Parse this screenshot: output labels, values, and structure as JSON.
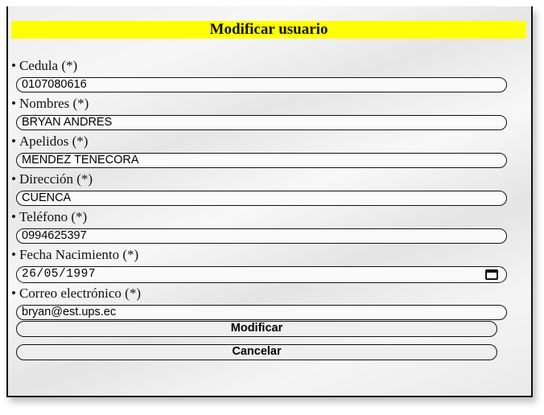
{
  "form": {
    "title": "Modificar usuario",
    "bullet": "•",
    "fields": [
      {
        "label": "Cedula (*)",
        "value": "0107080616"
      },
      {
        "label": "Nombres (*)",
        "value": "BRYAN ANDRES"
      },
      {
        "label": "Apelidos (*)",
        "value": "MENDEZ TENECORA"
      },
      {
        "label": "Dirección (*)",
        "value": "CUENCA"
      },
      {
        "label": "Teléfono (*)",
        "value": "0994625397"
      },
      {
        "label": "Fecha Nacimiento (*)",
        "value": "26/05/1997"
      },
      {
        "label": "Correo electrónico (*)",
        "value": "bryan@est.ups.ec"
      }
    ],
    "buttons": {
      "submit": "Modificar",
      "cancel": "Cancelar"
    }
  }
}
